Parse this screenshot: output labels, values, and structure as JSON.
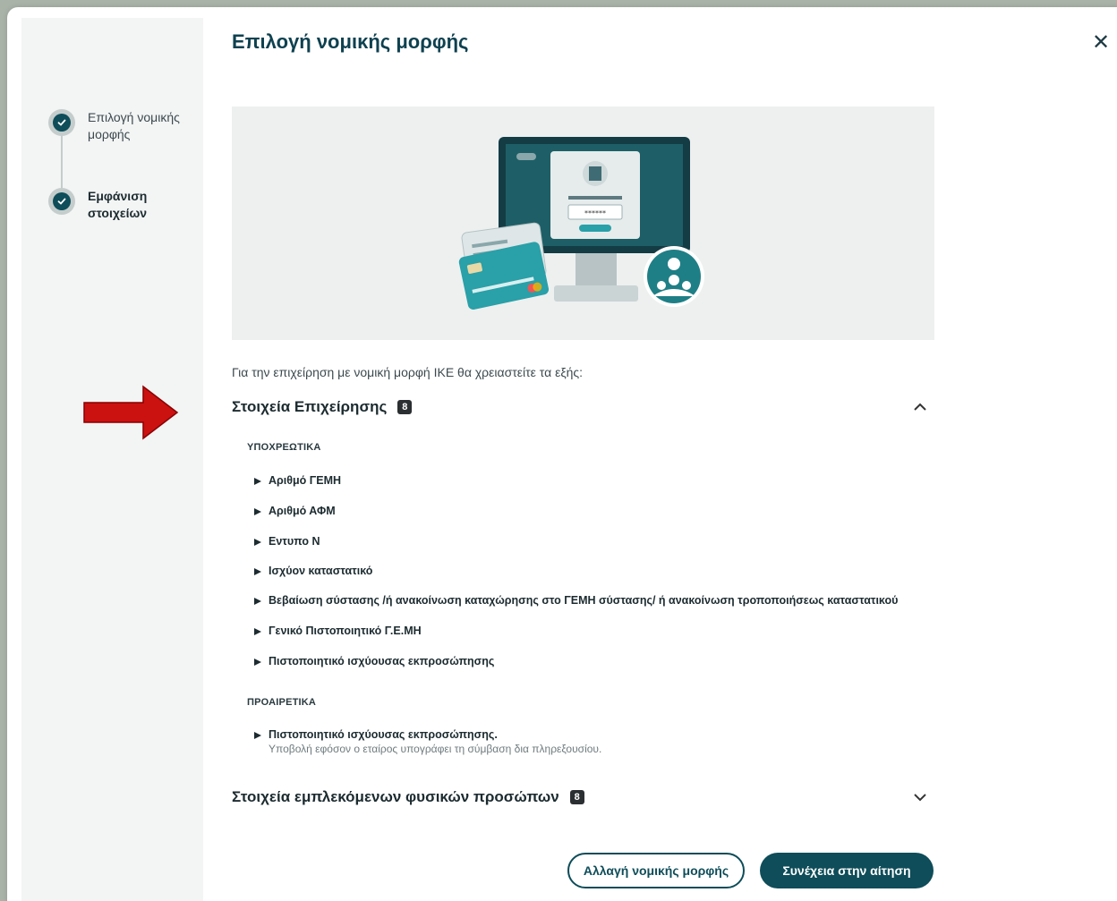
{
  "dialog": {
    "title": "Επιλογή νομικής μορφής",
    "close_label": "✕"
  },
  "steps": [
    {
      "label": "Επιλογή νομικής μορφής",
      "state": "done"
    },
    {
      "label": "Εμφάνιση στοιχείων",
      "state": "active"
    }
  ],
  "intro": "Για την επιχείρηση με νομική μορφή ΙΚΕ θα χρειαστείτε τα εξής:",
  "sections": [
    {
      "title": "Στοιχεία Επιχείρησης",
      "count": "8",
      "expanded": true,
      "required_label": "ΥΠΟΧΡΕΩΤΙΚΑ",
      "required_items": [
        "Αριθμό ΓΕΜΗ",
        "Αριθμό ΑΦΜ",
        "Εντυπο Ν",
        "Ισχύον καταστατικό",
        "Βεβαίωση σύστασης /ή ανακοίνωση καταχώρησης στο ΓΕΜΗ σύστασης/ ή ανακοίνωση τροποποιήσεως καταστατικού",
        "Γενικό Πιστοποιητικό Γ.Ε.ΜΗ",
        " Πιστοποιητικό ισχύουσας εκπροσώπησης"
      ],
      "optional_label": "ΠΡΟΑΙΡΕΤΙΚΑ",
      "optional_items": [
        {
          "title": "Πιστοποιητικό ισχύουσας εκπροσώπησης.",
          "note": "Υποβολή εφόσον ο εταίρος υπογράφει τη σύμβαση δια πληρεξουσίου."
        }
      ]
    },
    {
      "title": "Στοιχεία εμπλεκόμενων φυσικών προσώπων",
      "count": "8",
      "expanded": false
    }
  ],
  "buttons": {
    "change": "Αλλαγή νομικής μορφής",
    "continue": "Συνέχεια στην αίτηση"
  },
  "colors": {
    "primary": "#0e4d59",
    "accent_teal": "#2aa0a8",
    "annotation_arrow": "#cc1111"
  }
}
